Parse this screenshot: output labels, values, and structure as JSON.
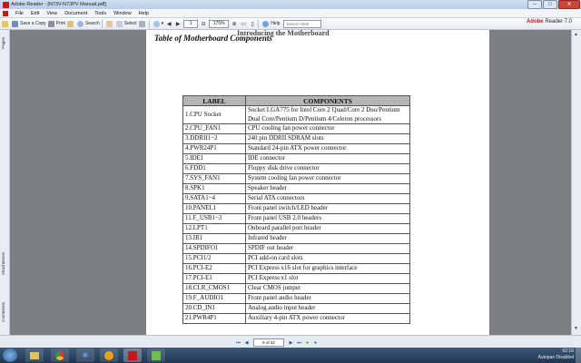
{
  "window": {
    "title": "Adobe Reader - [N73V-N73PV Manual.pdf]"
  },
  "menu": [
    "File",
    "Edit",
    "View",
    "Document",
    "Tools",
    "Window",
    "Help"
  ],
  "toolbar": {
    "save_copy": "Save a Copy",
    "print": "Print",
    "search": "Search",
    "select": "Select",
    "page_current": "1",
    "zoom": "175%",
    "help": "Help",
    "search_web_placeholder": "Search Web",
    "brand": "Adobe",
    "brand_product": "Reader 7.0"
  },
  "left_panel": {
    "pages": "Pages",
    "attachments": "Attachments",
    "comments": "Comments"
  },
  "document": {
    "header_cut": "Introducing the Motherboard",
    "heading": "Table of Motherboard Components",
    "table": {
      "headers": [
        "LABEL",
        "COMPONENTS"
      ],
      "rows": [
        [
          "1.CPU Socket",
          "Socket LGA775 for Intel Core 2 Quad/Core 2 Duo/Pentium Dual Core/Pentium D/Pentium 4/Celeron processors"
        ],
        [
          "2.CPU_FAN1",
          "CPU cooling fan power connector"
        ],
        [
          "3.DDRII1~2",
          "240 pin DDRII SDRAM slots"
        ],
        [
          "4.PWR24P1",
          "Standard 24-pin ATX power connector"
        ],
        [
          "5.IDE1",
          "IDE connector"
        ],
        [
          "6.FDD1",
          "Floppy disk drive connector"
        ],
        [
          "7.SYS_FAN1",
          "System cooling fan power connector"
        ],
        [
          "8.SPK1",
          "Speaker header"
        ],
        [
          "9.SATA1~4",
          "Serial ATA connectors"
        ],
        [
          "10.PANEL1",
          "Front panel switch/LED header"
        ],
        [
          "11.F_USB1~3",
          "Front panel USB 2.0 headers"
        ],
        [
          "12.LPT1",
          "Onboard parallel port header"
        ],
        [
          "13.IR1",
          "Infrared header"
        ],
        [
          "14.SPDIFO1",
          "SPDIF out header"
        ],
        [
          "15.PCI1/2",
          "PCI add-on card slots"
        ],
        [
          "16.PCI-E2",
          "PCI Express x16 slot for graphics interface"
        ],
        [
          "17.PCI-E1",
          "PCI Express x1 slot"
        ],
        [
          "18.CLR_CMOS1",
          "Clear CMOS jumper"
        ],
        [
          "19.F_AUDIO1",
          "Front panel audio header"
        ],
        [
          "20.CD_IN1",
          "Analog audio input header"
        ],
        [
          "21.PWR4P1",
          "Auxiliary 4-pin ATX power connector"
        ]
      ]
    }
  },
  "status": {
    "page_of": "6 of 32"
  },
  "taskbar": {
    "time": "02:16",
    "tray_text": "Autopan Disabled"
  },
  "colors": {
    "header_fill": "#b5b5b5",
    "accent": "#c4161c"
  }
}
